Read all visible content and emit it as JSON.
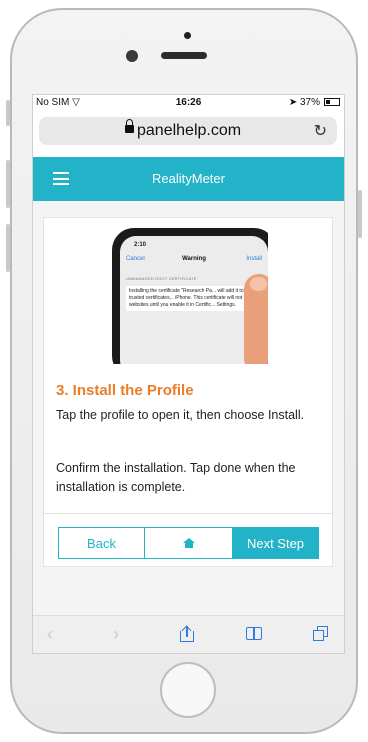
{
  "status_bar": {
    "carrier": "No SIM",
    "time": "16:26",
    "battery": "37%",
    "battery_level": 0.37
  },
  "browser": {
    "url": "panelhelp.com",
    "reload_icon": "reload-icon"
  },
  "app_bar": {
    "title": "RealityMeter",
    "menu_icon": "hamburger-menu-icon"
  },
  "illustration": {
    "time": "2:10",
    "cancel": "Cancel",
    "title": "Warning",
    "install": "Install",
    "section": "UNMANAGED ROOT CERTIFICATE",
    "body": "Installing the certificate \"Research Pa... will add it to the list of trusted certificates... iPhone. This certificate will not be trus... websites until you enable it in Certific... Settings."
  },
  "step": {
    "title": "3. Install the Profile",
    "paragraph1": "Tap the profile to open it, then choose Install.",
    "paragraph2": "Confirm the installation. Tap done when the installation is complete."
  },
  "nav": {
    "back": "Back",
    "home_icon": "home-icon",
    "next": "Next Step"
  },
  "safari_toolbar": {
    "icons": [
      "back-arrow-icon",
      "forward-arrow-icon",
      "share-icon",
      "bookmarks-icon",
      "tabs-icon"
    ]
  },
  "colors": {
    "accent": "#22b3c8",
    "step_title": "#ec7d27"
  }
}
